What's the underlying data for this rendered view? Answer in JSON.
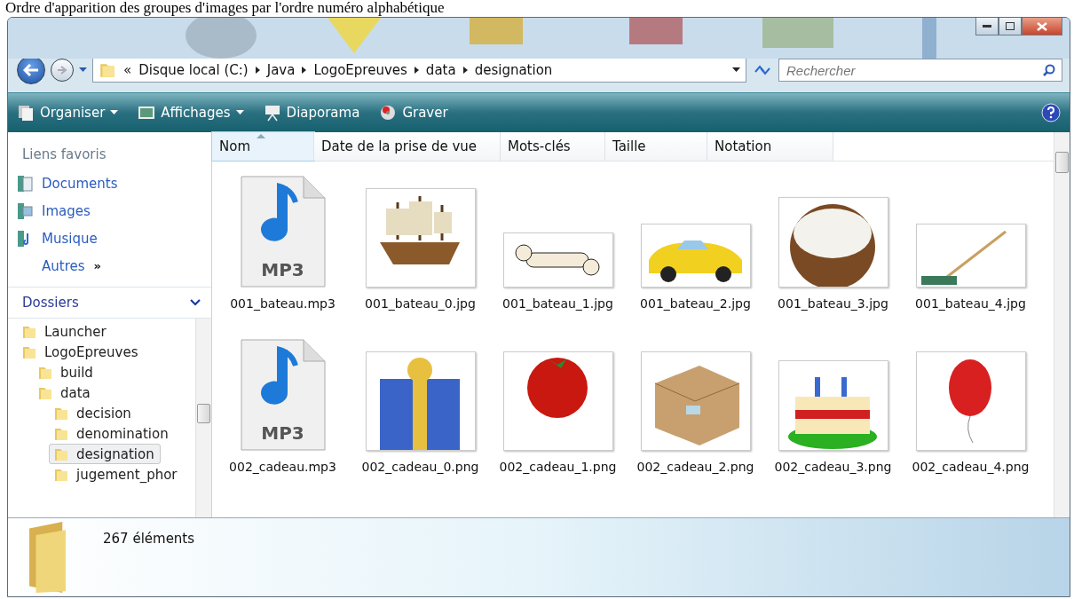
{
  "caption": "Ordre d'apparition des groupes d'images par l'ordre numéro alphabétique",
  "address": {
    "crumbs": [
      "«",
      "Disque local (C:)",
      "Java",
      "LogoEpreuves",
      "data",
      "designation"
    ],
    "search_placeholder": "Rechercher"
  },
  "toolbar": [
    {
      "label": "Organiser",
      "kind": "menu"
    },
    {
      "label": "Affichages",
      "kind": "menu"
    },
    {
      "label": "Diaporama",
      "kind": "slideshow"
    },
    {
      "label": "Graver",
      "kind": "burn"
    }
  ],
  "sidebar": {
    "favorites_title": "Liens favoris",
    "links": [
      {
        "label": "Documents",
        "kind": "docs"
      },
      {
        "label": "Images",
        "kind": "images"
      },
      {
        "label": "Musique",
        "kind": "music"
      },
      {
        "label": "Autres",
        "kind": "more",
        "arrow": "»"
      }
    ],
    "folders_title": "Dossiers",
    "tree": [
      {
        "label": "Launcher",
        "selected": false
      },
      {
        "label": "LogoEpreuves",
        "selected": false,
        "children": [
          {
            "label": "build",
            "selected": false
          },
          {
            "label": "data",
            "selected": false,
            "children": [
              {
                "label": "decision",
                "selected": false
              },
              {
                "label": "denomination",
                "selected": false
              },
              {
                "label": "designation",
                "selected": true
              },
              {
                "label": "jugement_phor",
                "selected": false
              }
            ]
          }
        ]
      }
    ]
  },
  "columns": [
    {
      "label": "Nom",
      "selected": true
    },
    {
      "label": "Date de la prise de vue",
      "selected": false
    },
    {
      "label": "Mots-clés",
      "selected": false
    },
    {
      "label": "Taille",
      "selected": false
    },
    {
      "label": "Notation",
      "selected": false
    }
  ],
  "files": [
    {
      "name": "001_bateau.mp3",
      "kind": "audio",
      "badge": "MP3"
    },
    {
      "name": "001_bateau_0.jpg"
    },
    {
      "name": "001_bateau_1.jpg"
    },
    {
      "name": "001_bateau_2.jpg"
    },
    {
      "name": "001_bateau_3.jpg"
    },
    {
      "name": "001_bateau_4.jpg"
    },
    {
      "name": "002_cadeau.mp3",
      "kind": "audio",
      "badge": "MP3"
    },
    {
      "name": "002_cadeau_0.png"
    },
    {
      "name": "002_cadeau_1.png"
    },
    {
      "name": "002_cadeau_2.png"
    },
    {
      "name": "002_cadeau_3.png"
    },
    {
      "name": "002_cadeau_4.png"
    }
  ],
  "status": {
    "count": "267 éléments"
  }
}
